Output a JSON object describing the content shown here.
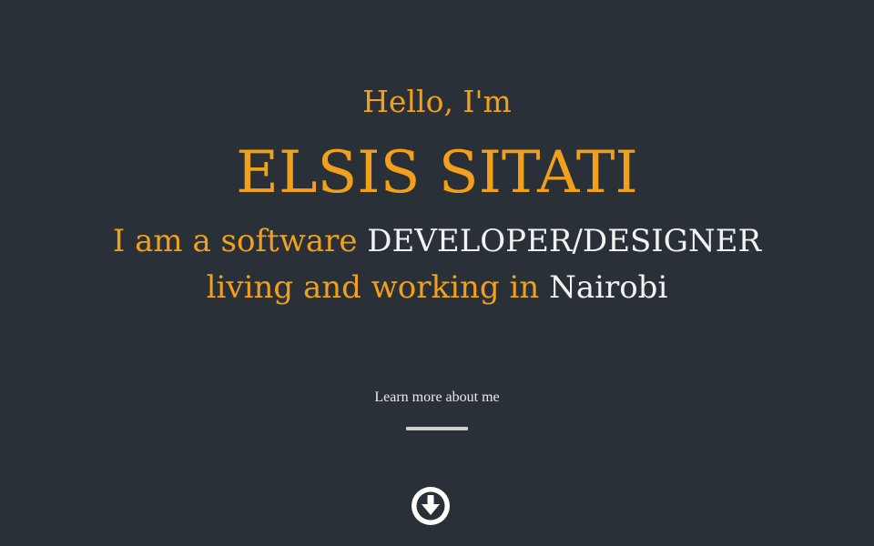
{
  "hero": {
    "greeting": "Hello, I'm",
    "name": "ELSIS SITATI",
    "line1_prefix": "I am a software",
    "line1_highlight": "DEVELOPER/DESIGNER",
    "line2_prefix": "living and working in",
    "line2_highlight": "Nairobi",
    "learn_more": "Learn more about me",
    "scroll_icon": "arrow-down-circle-icon"
  },
  "theme": {
    "background": "#2a3038",
    "accent": "#f0a01a",
    "text_light": "#f2f2f2"
  }
}
